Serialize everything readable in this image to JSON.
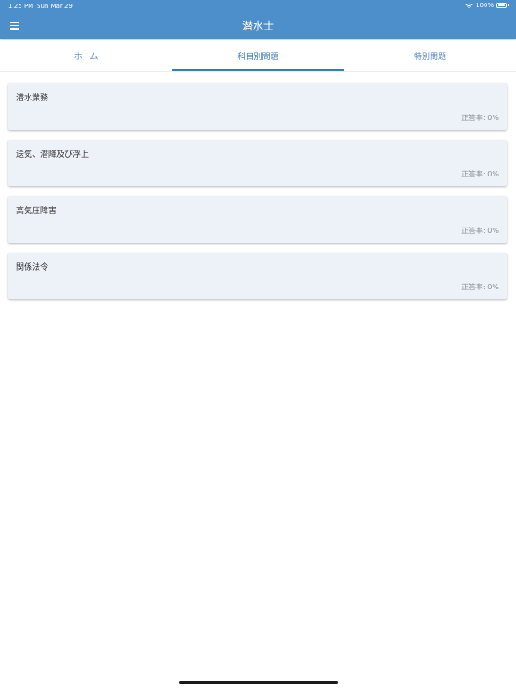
{
  "status_bar": {
    "time": "1:25 PM",
    "date": "Sun Mar 29",
    "battery": "100%"
  },
  "header": {
    "title": "潜水士",
    "menu_icon": "hamburger-menu-icon",
    "color": "#4d8fca"
  },
  "tabs": [
    {
      "label": "ホーム",
      "active": false
    },
    {
      "label": "科目別問題",
      "active": true
    },
    {
      "label": "特別問題",
      "active": false
    }
  ],
  "subjects": [
    {
      "title": "潜水業務",
      "rate": "正答率: 0%"
    },
    {
      "title": "送気、潜降及び浮上",
      "rate": "正答率: 0%"
    },
    {
      "title": "高気圧障害",
      "rate": "正答率: 0%"
    },
    {
      "title": "関係法令",
      "rate": "正答率: 0%"
    }
  ],
  "colors": {
    "accent": "#3e7ab3",
    "card_background": "#edf2f9"
  }
}
